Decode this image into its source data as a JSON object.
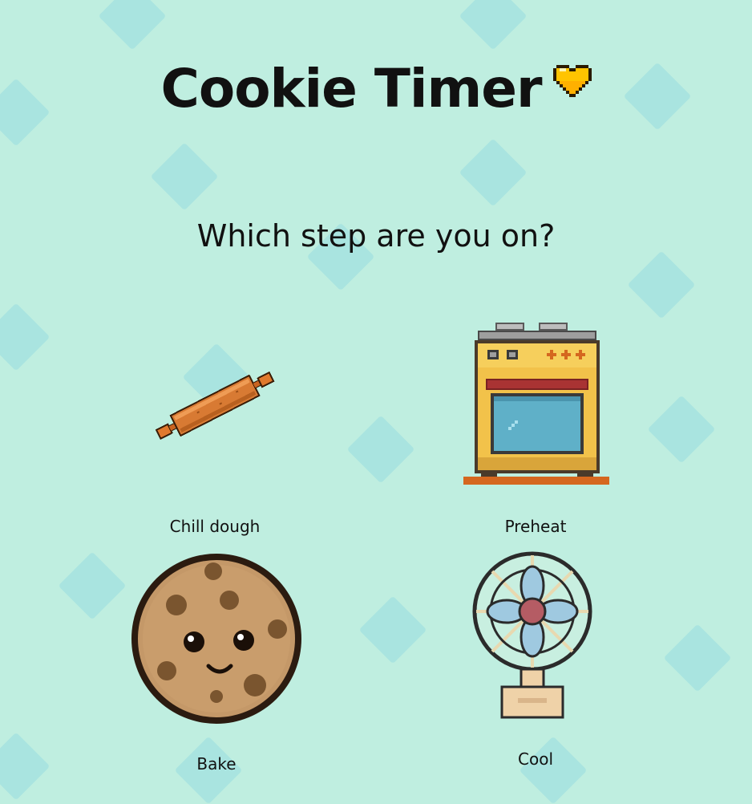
{
  "header": {
    "title": "Cookie Timer",
    "title_icon": "heart-icon",
    "heart_color": "#ffc400"
  },
  "prompt": {
    "question": "Which step are you on?"
  },
  "steps": [
    {
      "label": "Chill dough",
      "icon": "rolling-pin-icon"
    },
    {
      "label": "Preheat",
      "icon": "oven-icon"
    },
    {
      "label": "Bake",
      "icon": "cookie-icon"
    },
    {
      "label": "Cool",
      "icon": "fan-icon"
    }
  ],
  "theme": {
    "background": "#bfeee0",
    "diamond": "#8fd8df"
  }
}
